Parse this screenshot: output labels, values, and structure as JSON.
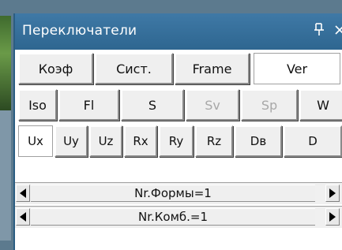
{
  "panel": {
    "title": "Переключатели",
    "pin_glyph": "ᵖ",
    "close_glyph": "×"
  },
  "rows": [
    {
      "buttons": [
        {
          "label": "Коэф",
          "state": "normal"
        },
        {
          "label": "Сист.",
          "state": "normal"
        },
        {
          "label": "Frame",
          "state": "normal"
        },
        {
          "label": "Ver",
          "state": "active"
        }
      ]
    },
    {
      "buttons": [
        {
          "label": "Iso",
          "state": "normal"
        },
        {
          "label": "Fl",
          "state": "normal"
        },
        {
          "label": "S",
          "state": "normal"
        },
        {
          "label": "Sv",
          "state": "disabled"
        },
        {
          "label": "Sp",
          "state": "disabled"
        },
        {
          "label": "W",
          "state": "normal"
        }
      ]
    },
    {
      "buttons": [
        {
          "label": "Ux",
          "state": "active"
        },
        {
          "label": "Uy",
          "state": "normal"
        },
        {
          "label": "Uz",
          "state": "normal"
        },
        {
          "label": "Rx",
          "state": "normal"
        },
        {
          "label": "Ry",
          "state": "normal"
        },
        {
          "label": "Rz",
          "state": "normal"
        },
        {
          "label": "Dв",
          "state": "normal"
        },
        {
          "label": "D",
          "state": "normal"
        }
      ]
    }
  ],
  "selectors": [
    {
      "label": "Nr.Формы=1"
    },
    {
      "label": "Nr.Комб.=1"
    }
  ]
}
